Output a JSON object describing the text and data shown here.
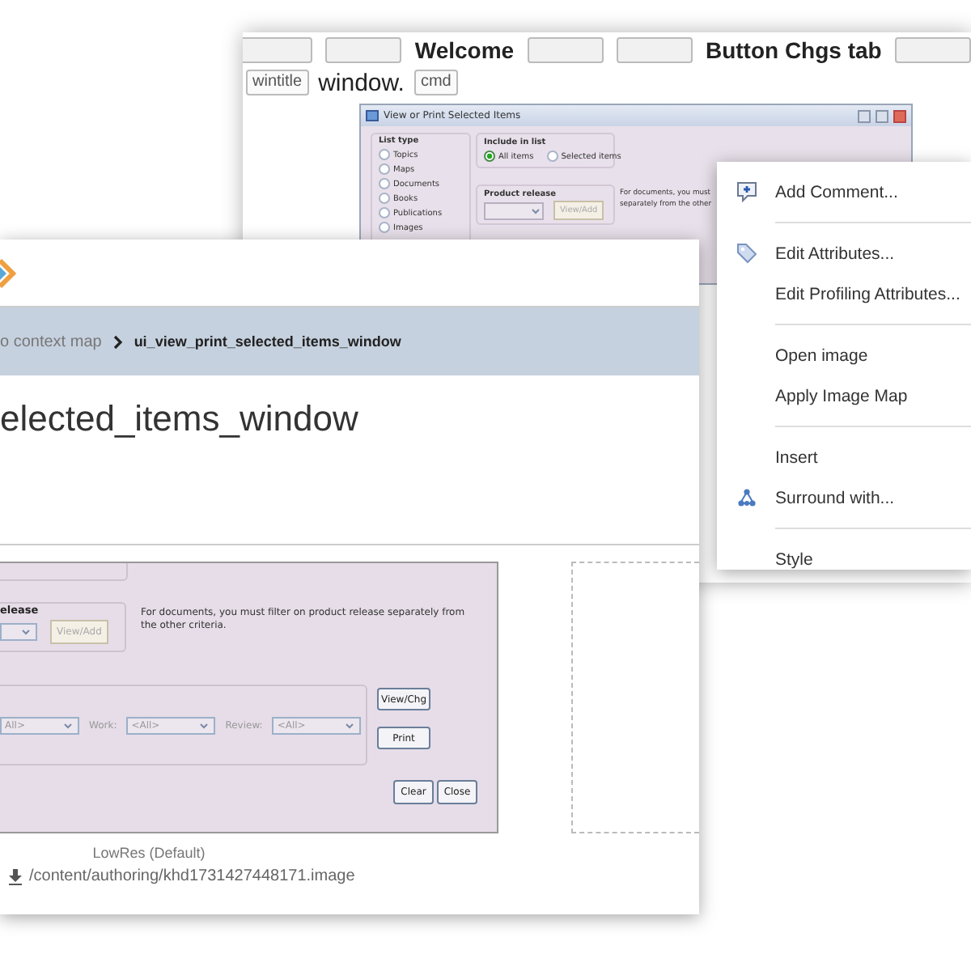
{
  "back_window": {
    "tag_row_1": [
      {
        "kind": "tag"
      },
      {
        "kind": "tag"
      },
      {
        "kind": "text",
        "text": "Welcome"
      },
      {
        "kind": "tag"
      },
      {
        "kind": "tag"
      },
      {
        "kind": "text",
        "text": "Button Chgs tab"
      },
      {
        "kind": "tag"
      }
    ],
    "tag_row_2": [
      {
        "kind": "tag",
        "text": "wintitle"
      },
      {
        "kind": "text",
        "text": "window."
      },
      {
        "kind": "tag",
        "text": "cmd"
      }
    ],
    "dialog": {
      "title": "View or Print Selected Items",
      "list_type": {
        "label": "List type",
        "options": [
          {
            "label": "Topics",
            "selected": false
          },
          {
            "label": "Maps",
            "selected": false
          },
          {
            "label": "Documents",
            "selected": false
          },
          {
            "label": "Books",
            "selected": false
          },
          {
            "label": "Publications",
            "selected": false
          },
          {
            "label": "Images",
            "selected": false
          }
        ]
      },
      "include_in_list": {
        "label": "Include in list",
        "options": [
          {
            "label": "All items",
            "selected": true
          },
          {
            "label": "Selected items",
            "selected": false
          }
        ]
      },
      "product_release": {
        "label": "Product release",
        "button": {
          "label": "View/Add",
          "disabled": true
        }
      },
      "note_lines": [
        "For documents, you must",
        "separately from the other"
      ]
    }
  },
  "front_window": {
    "breadcrumb": {
      "parent": "o context map",
      "current": "ui_view_print_selected_items_window"
    },
    "title": "elected_items_window",
    "dialog": {
      "release_group": {
        "label": "elease",
        "button": {
          "label": "View/Add",
          "disabled": true
        }
      },
      "note": "For documents, you must filter on product release separately from the other criteria.",
      "filters": [
        {
          "value": "All>"
        },
        {
          "label": "Work:",
          "value": "<All>"
        },
        {
          "label": "Review:",
          "value": "<All>"
        }
      ],
      "side_buttons": [
        "View/Chg",
        "Print"
      ],
      "bottom_buttons": [
        "Clear",
        "Close"
      ]
    },
    "caption": "LowRes (Default)",
    "path": "/content/authoring/khd1731427448171.image"
  },
  "context_menu": {
    "groups": [
      [
        {
          "label": "Add Comment...",
          "kind": "comment"
        }
      ],
      [
        {
          "label": "Edit Attributes...",
          "kind": "tag"
        },
        {
          "label": "Edit Profiling Attributes...",
          "kind": "plain"
        }
      ],
      [
        {
          "label": "Open image",
          "kind": "plain"
        },
        {
          "label": "Apply Image Map",
          "kind": "plain"
        }
      ],
      [
        {
          "label": "Insert",
          "kind": "plain"
        },
        {
          "label": "Surround with...",
          "kind": "hierarchy"
        }
      ],
      [
        {
          "label": "Style",
          "kind": "plain"
        }
      ]
    ]
  }
}
